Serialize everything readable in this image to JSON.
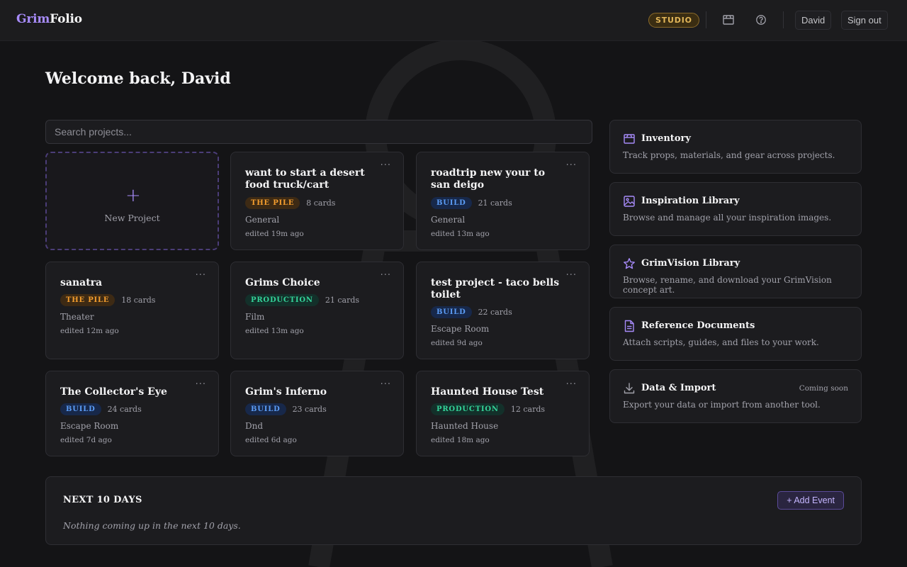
{
  "header": {
    "logo_part1": "Grim",
    "logo_part2": "Folio",
    "plan_badge": "STUDIO",
    "user_button": "David",
    "signout_button": "Sign out"
  },
  "welcome": "Welcome back, David",
  "search": {
    "placeholder": "Search projects..."
  },
  "new_project": {
    "label": "New Project"
  },
  "projects": [
    {
      "title": "want to start a desert food truck/cart",
      "status": "THE PILE",
      "cards": "8 cards",
      "category": "General",
      "edited": "edited 19m ago"
    },
    {
      "title": "roadtrip new your to san deigo",
      "status": "BUILD",
      "cards": "21 cards",
      "category": "General",
      "edited": "edited 13m ago"
    },
    {
      "title": "sanatra",
      "status": "THE PILE",
      "cards": "18 cards",
      "category": "Theater",
      "edited": "edited 12m ago"
    },
    {
      "title": "Grims Choice",
      "status": "PRODUCTION",
      "cards": "21 cards",
      "category": "Film",
      "edited": "edited 13m ago"
    },
    {
      "title": "test project - taco bells toilet",
      "status": "BUILD",
      "cards": "22 cards",
      "category": "Escape Room",
      "edited": "edited 9d ago"
    },
    {
      "title": "The Collector's Eye",
      "status": "BUILD",
      "cards": "24 cards",
      "category": "Escape Room",
      "edited": "edited 7d ago"
    },
    {
      "title": "Grim's Inferno",
      "status": "BUILD",
      "cards": "23 cards",
      "category": "Dnd",
      "edited": "edited 6d ago"
    },
    {
      "title": "Haunted House Test",
      "status": "PRODUCTION",
      "cards": "12 cards",
      "category": "Haunted House",
      "edited": "edited 18m ago"
    }
  ],
  "card_menu": "···",
  "panels": [
    {
      "icon": "box-icon",
      "title": "Inventory",
      "desc": "Track props, materials, and gear across projects."
    },
    {
      "icon": "image-icon",
      "title": "Inspiration Library",
      "desc": "Browse and manage all your inspiration images."
    },
    {
      "icon": "star-icon",
      "title": "GrimVision Library",
      "desc": "Browse, rename, and download your GrimVision concept art."
    },
    {
      "icon": "document-icon",
      "title": "Reference Documents",
      "desc": "Attach scripts, guides, and files to your work."
    },
    {
      "icon": "download-icon",
      "title": "Data & Import",
      "desc": "Export your data or import from another tool.",
      "note": "Coming soon"
    }
  ],
  "events": {
    "title": "NEXT 10 DAYS",
    "empty": "Nothing coming up in the next 10 days.",
    "add_button": "+ Add Event"
  },
  "colors": {
    "accent": "#a78bfa",
    "pile": "#f59e2e",
    "build": "#5b9cf5",
    "production": "#34d399",
    "studio": "#e2b659"
  }
}
